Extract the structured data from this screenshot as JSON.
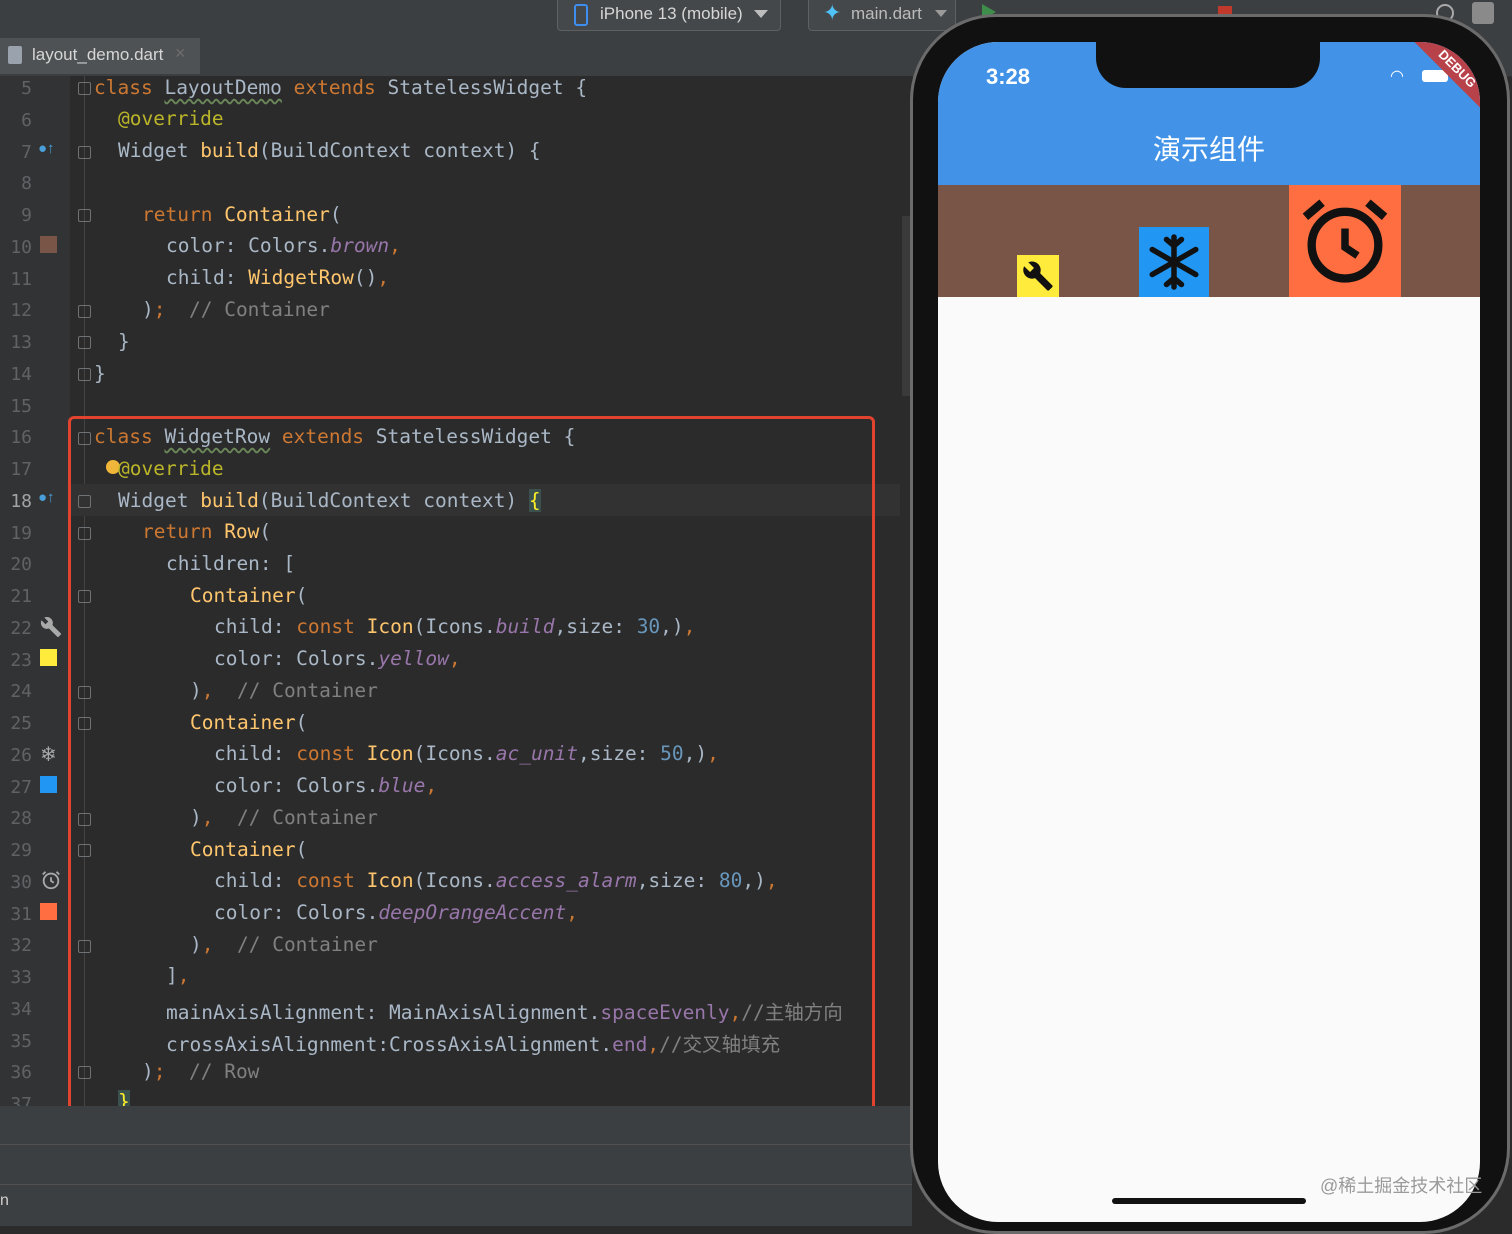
{
  "toolbar": {
    "device": "iPhone 13 (mobile)",
    "run_config": "main.dart"
  },
  "editor_tab": {
    "filename": "layout_demo.dart"
  },
  "code": {
    "line_numbers": [
      "5",
      "6",
      "7",
      "8",
      "9",
      "10",
      "11",
      "12",
      "13",
      "14",
      "15",
      "16",
      "17",
      "18",
      "19",
      "20",
      "21",
      "22",
      "23",
      "24",
      "25",
      "26",
      "27",
      "28",
      "29",
      "30",
      "31",
      "32",
      "33",
      "34",
      "35",
      "36",
      "37"
    ],
    "l5": [
      "class ",
      "LayoutDemo",
      " extends ",
      "StatelessWidget {"
    ],
    "l6": [
      "@override"
    ],
    "l7": [
      "Widget ",
      "build",
      "(BuildContext context) {"
    ],
    "l9": [
      "return ",
      "Container",
      "("
    ],
    "l10": [
      "color: Colors.",
      "brown",
      ","
    ],
    "l11": [
      "child: ",
      "WidgetRow",
      "()",
      ","
    ],
    "l12": [
      ")",
      ";  ",
      "// Container"
    ],
    "l13": [
      "}"
    ],
    "l14": [
      "}"
    ],
    "l16": [
      "class ",
      "WidgetRow",
      " extends ",
      "StatelessWidget {"
    ],
    "l17": [
      "@override"
    ],
    "l18": [
      "Widget ",
      "build",
      "(BuildContext context) ",
      "{"
    ],
    "l19": [
      "return ",
      "Row",
      "("
    ],
    "l20": [
      "children: ["
    ],
    "l21": [
      "Container",
      "("
    ],
    "l22": [
      "child: ",
      "const ",
      "Icon",
      "(Icons.",
      "build",
      ",size: ",
      "30",
      ",)",
      ","
    ],
    "l23": [
      "color: Colors.",
      "yellow",
      ","
    ],
    "l24": [
      ")",
      ",  ",
      "// Container"
    ],
    "l25": [
      "Container",
      "("
    ],
    "l26": [
      "child: ",
      "const ",
      "Icon",
      "(Icons.",
      "ac_unit",
      ",size: ",
      "50",
      ",)",
      ","
    ],
    "l27": [
      "color: Colors.",
      "blue",
      ","
    ],
    "l28": [
      ")",
      ",  ",
      "// Container"
    ],
    "l29": [
      "Container",
      "("
    ],
    "l30": [
      "child: ",
      "const ",
      "Icon",
      "(Icons.",
      "access_alarm",
      ",size: ",
      "80",
      ",)",
      ","
    ],
    "l31": [
      "color: Colors.",
      "deepOrangeAccent",
      ","
    ],
    "l32": [
      ")",
      ",  ",
      "// Container"
    ],
    "l33": [
      "]",
      ","
    ],
    "l34": [
      "mainAxisAlignment: MainAxisAlignment.",
      "spaceEvenly",
      ",",
      "//主轴方向"
    ],
    "l35": [
      "crossAxisAlignment:CrossAxisAlignment.",
      "end",
      ",",
      "//交叉轴填充"
    ],
    "l36": [
      ")",
      ";  ",
      "// Row"
    ],
    "l37": [
      "}"
    ]
  },
  "gutter_icons": {
    "l7": "override-method-icon",
    "l10": "color-swatch-brown",
    "l18": "override-method-icon",
    "l22": "wrench-icon",
    "l23": "color-swatch-yellow",
    "l26": "snowflake-icon",
    "l27": "color-swatch-blue",
    "l30": "alarm-clock-icon",
    "l31": "color-swatch-deep-orange"
  },
  "colors": {
    "brown": "#795548",
    "yellow": "#ffeb3b",
    "blue": "#2196f3",
    "deep_orange_accent": "#ff6e40",
    "app_bar": "#4293e7",
    "highlight_box": "#e0432e"
  },
  "phone": {
    "time": "3:28",
    "debug_banner": "DEBUG",
    "app_title": "演示组件",
    "icons": [
      "wrench-icon",
      "snowflake-icon",
      "alarm-clock-icon"
    ]
  },
  "watermark": "@稀土掘金技术社区",
  "bottom_edge_text": "n"
}
